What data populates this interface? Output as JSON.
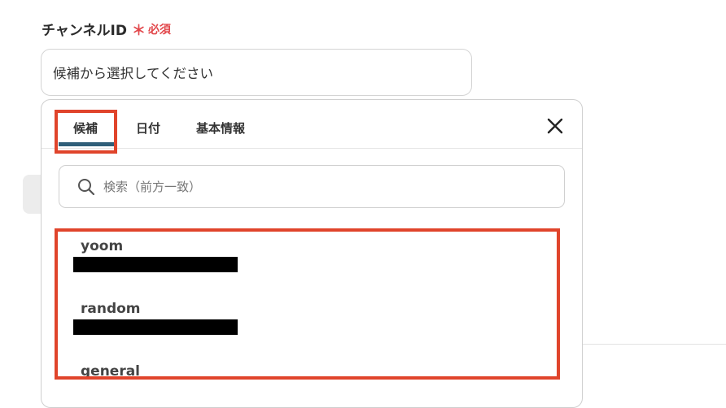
{
  "field": {
    "label": "チャンネルID",
    "required_mark": "＊",
    "required_text": "必須",
    "placeholder": "候補から選択してください"
  },
  "dropdown": {
    "tabs": [
      {
        "label": "候補",
        "active": true
      },
      {
        "label": "日付",
        "active": false
      },
      {
        "label": "基本情報",
        "active": false
      }
    ],
    "close_icon": "close-icon",
    "search": {
      "icon": "search-icon",
      "placeholder": "検索（前方一致）"
    },
    "options": [
      {
        "name": "yoom"
      },
      {
        "name": "random"
      },
      {
        "name": "general"
      }
    ]
  },
  "colors": {
    "required": "#e2474b",
    "tab_underline": "#2f5e78",
    "highlight": "#e0442b"
  }
}
